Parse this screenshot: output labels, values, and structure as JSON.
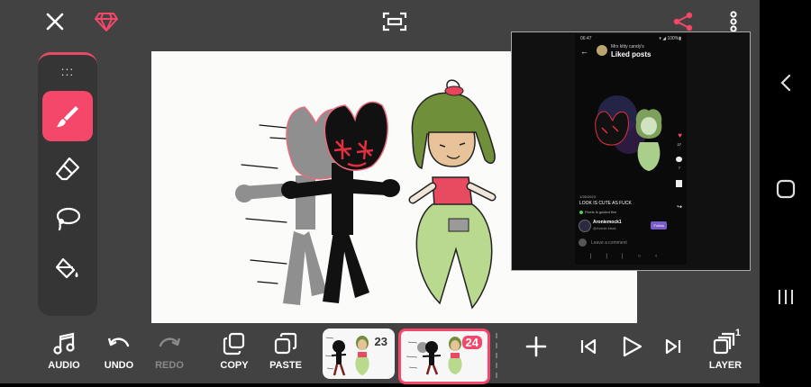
{
  "topbar": {
    "close_icon": "close-icon",
    "premium_icon": "gem-icon",
    "fit_icon": "fit-screen-icon",
    "share_icon": "share-icon",
    "more_icon": "more-vert-icon"
  },
  "tools": [
    {
      "name": "brush",
      "icon": "brush-icon",
      "active": true
    },
    {
      "name": "eraser",
      "icon": "eraser-icon",
      "active": false
    },
    {
      "name": "lasso",
      "icon": "lasso-icon",
      "active": false
    },
    {
      "name": "fill",
      "icon": "fill-bucket-icon",
      "active": false
    }
  ],
  "tool_grip": ":::",
  "bottombar": {
    "audio_label": "AUDIO",
    "undo_label": "UNDO",
    "redo_label": "REDO",
    "copy_label": "COPY",
    "paste_label": "PASTE",
    "layer_label": "LAYER",
    "layer_count": "1",
    "frames": [
      {
        "number": "23",
        "selected": false
      },
      {
        "number": "24",
        "selected": true
      }
    ]
  },
  "pip": {
    "status_time": "06:47",
    "status_right": "▾ ◢ 100%▮",
    "profile_name": "Mrs kitty candy's",
    "screen_title": "Liked posts",
    "like_count": "27",
    "comment_count": "7",
    "post_date": "1/26/2023",
    "caption": "LOOK IS CUTE AS FUCK",
    "pixels_tag": "Pixels is guided fine",
    "username": "Aroniemock1",
    "handle": "@Aronie.kissk",
    "follow_label": "Follow",
    "comment_placeholder": "Leave a comment"
  },
  "colors": {
    "accent": "#f4476a",
    "panel": "#353535",
    "background": "#424242",
    "canvas": "#fbfbf9"
  }
}
